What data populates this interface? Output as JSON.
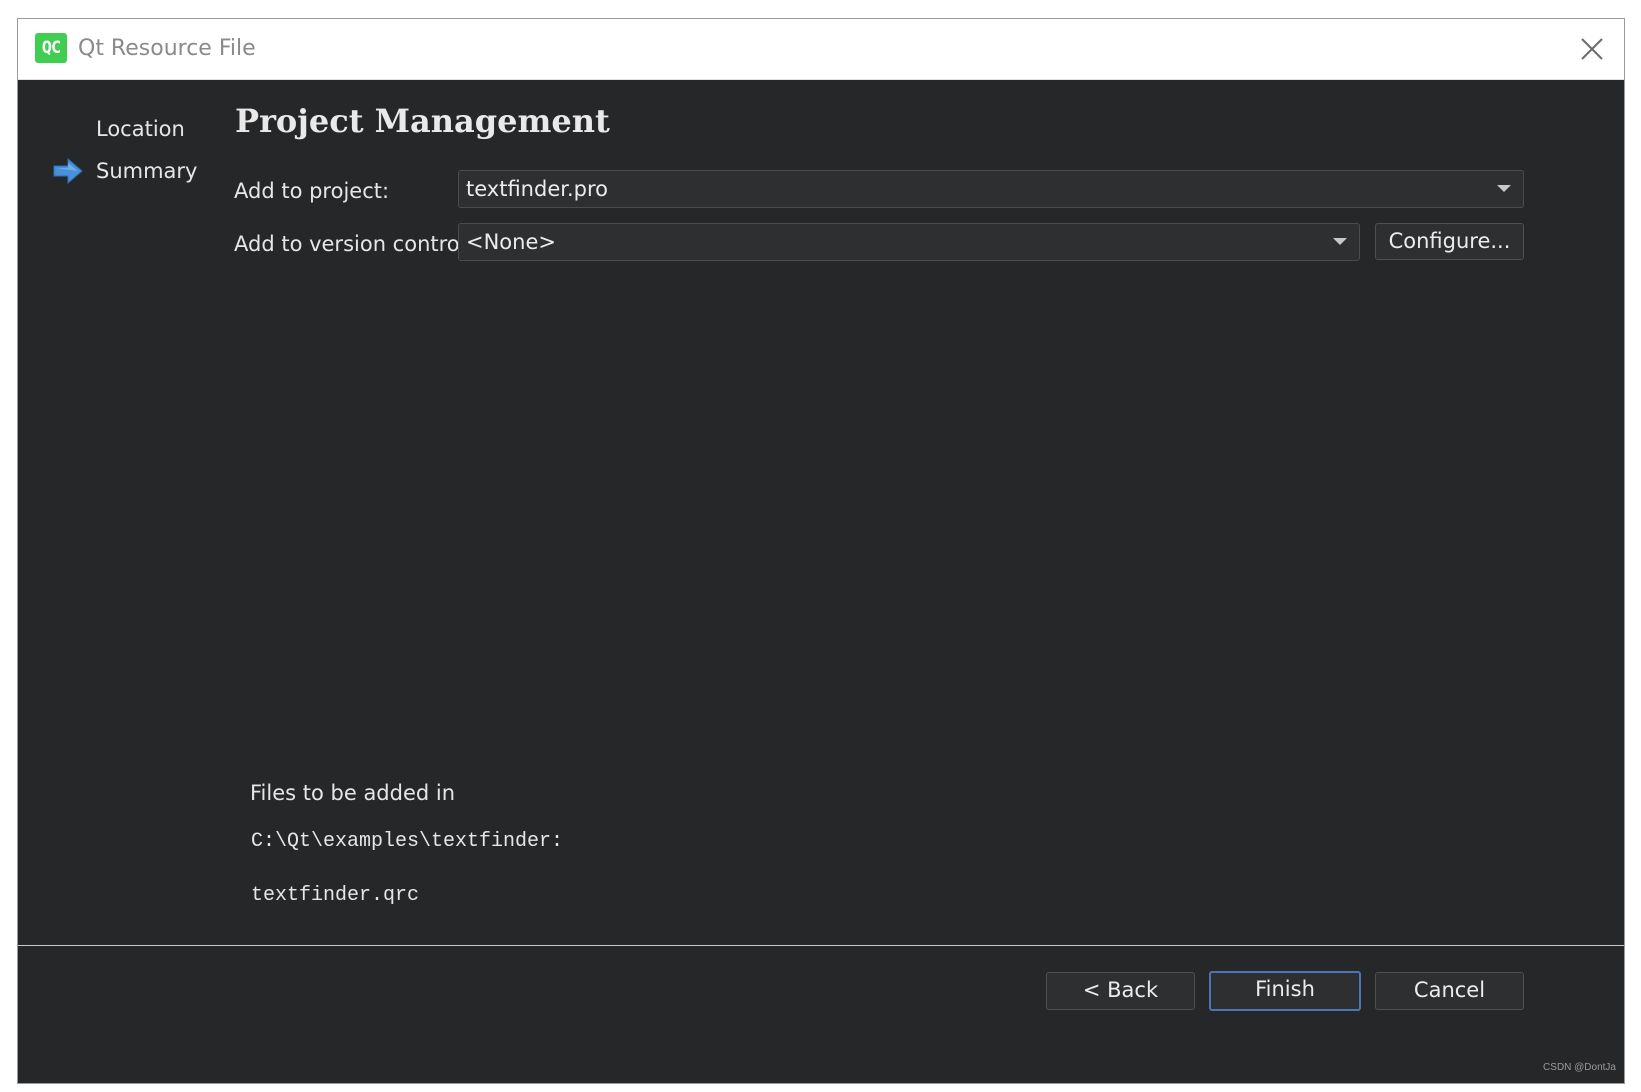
{
  "window": {
    "title": "Qt Resource File",
    "app_icon_text": "QC",
    "app_icon": "qt-creator-icon",
    "close_icon": "close-icon"
  },
  "sidebar": {
    "items": [
      {
        "label": "Location",
        "active": false
      },
      {
        "label": "Summary",
        "active": true,
        "icon": "right-arrow-icon"
      }
    ]
  },
  "page": {
    "title": "Project Management"
  },
  "form": {
    "add_to_project": {
      "label": "Add to project:",
      "value": "textfinder.pro"
    },
    "add_to_version_control": {
      "label": "Add to version control:",
      "value": "<None>"
    },
    "configure_button": "Configure..."
  },
  "summary": {
    "heading": "Files to be added in",
    "directory": "C:\\Qt\\examples\\textfinder:",
    "files": [
      "textfinder.qrc"
    ]
  },
  "footer": {
    "back_button": "< Back",
    "finish_button": "Finish",
    "cancel_button": "Cancel"
  },
  "watermark": "CSDN @DontJa",
  "colors": {
    "background": "#262729",
    "accent": "#4a76b5",
    "arrow": "#4a90d9",
    "qt_green": "#41cd52"
  }
}
